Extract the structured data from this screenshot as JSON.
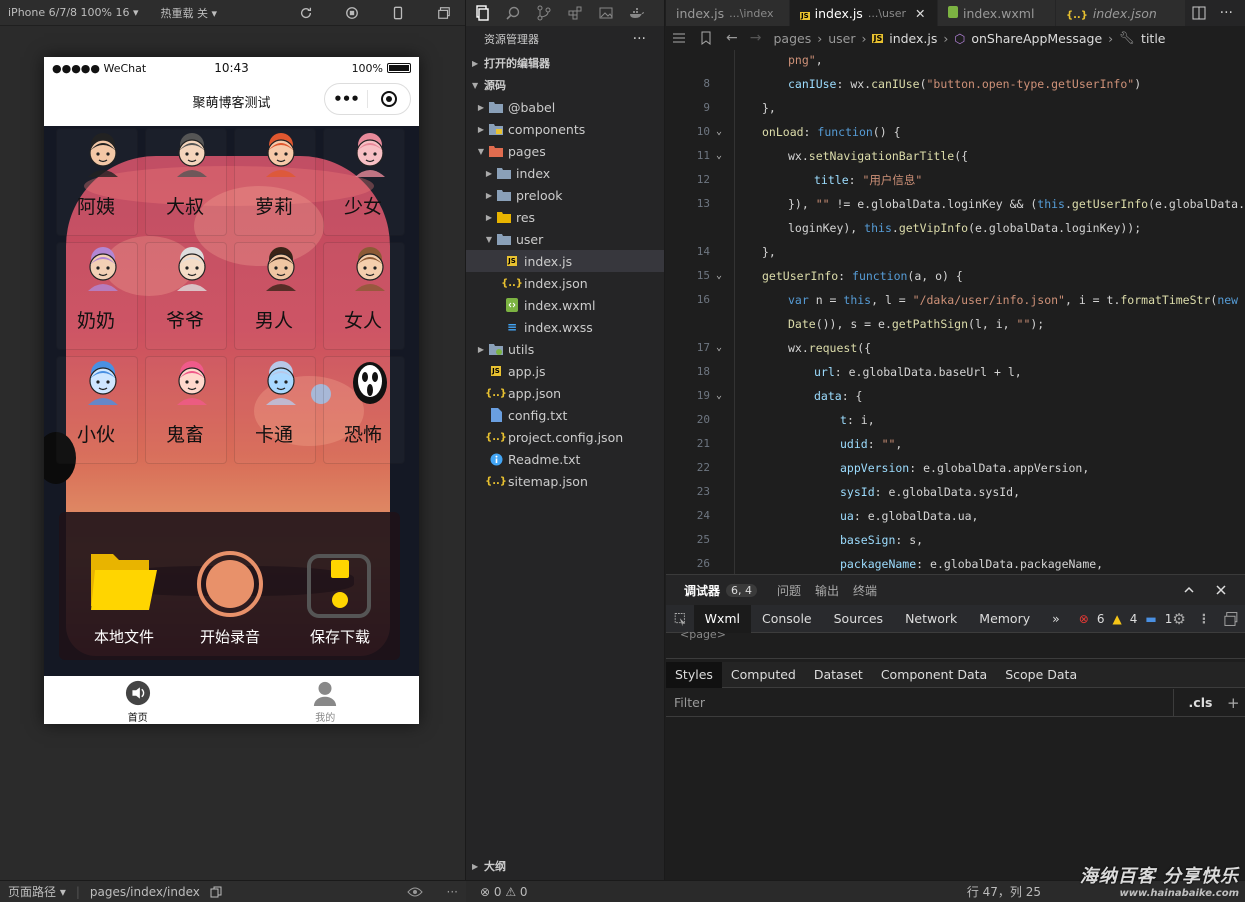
{
  "simulator": {
    "device_label": "iPhone 6/7/8 100% 16",
    "hot_reload_label": "热重载 关",
    "status_bar": {
      "carrier": "●●●●● WeChat",
      "time": "10:43",
      "battery": "100%"
    },
    "nav_title": "聚萌博客测试",
    "capsule_menu": "•••",
    "voices": [
      {
        "label": "阿姨",
        "icon": "aunt-avatar-icon"
      },
      {
        "label": "大叔",
        "icon": "uncle-avatar-icon"
      },
      {
        "label": "萝莉",
        "icon": "loli-avatar-icon"
      },
      {
        "label": "少女",
        "icon": "girl-avatar-icon"
      },
      {
        "label": "奶奶",
        "icon": "grandma-avatar-icon"
      },
      {
        "label": "爷爷",
        "icon": "grandpa-avatar-icon"
      },
      {
        "label": "男人",
        "icon": "man-avatar-icon"
      },
      {
        "label": "女人",
        "icon": "woman-avatar-icon"
      },
      {
        "label": "小伙",
        "icon": "boy-avatar-icon"
      },
      {
        "label": "鬼畜",
        "icon": "clown-avatar-icon"
      },
      {
        "label": "卡通",
        "icon": "cartoon-cat-icon"
      },
      {
        "label": "恐怖",
        "icon": "scream-mask-icon"
      }
    ],
    "actions": [
      {
        "label": "本地文件",
        "icon": "folder-icon"
      },
      {
        "label": "开始录音",
        "icon": "record-icon"
      },
      {
        "label": "保存下载",
        "icon": "save-icon"
      }
    ],
    "tabs": [
      {
        "label": "首页",
        "icon": "speaker-icon"
      },
      {
        "label": "我的",
        "icon": "user-icon"
      }
    ],
    "footer": {
      "path_label": "页面路径",
      "path": "pages/index/index"
    }
  },
  "explorer": {
    "title": "资源管理器",
    "open_editors": "打开的编辑器",
    "source": "源码",
    "outline": "大纲",
    "tree": [
      {
        "name": "@babel",
        "depth": 1,
        "kind": "folder",
        "state": "closed"
      },
      {
        "name": "components",
        "depth": 1,
        "kind": "folder-components",
        "state": "closed"
      },
      {
        "name": "pages",
        "depth": 1,
        "kind": "folder-pages",
        "state": "open"
      },
      {
        "name": "index",
        "depth": 2,
        "kind": "folder",
        "state": "closed"
      },
      {
        "name": "prelook",
        "depth": 2,
        "kind": "folder",
        "state": "closed"
      },
      {
        "name": "res",
        "depth": 2,
        "kind": "folder-yellow",
        "state": "closed"
      },
      {
        "name": "user",
        "depth": 2,
        "kind": "folder",
        "state": "open"
      },
      {
        "name": "index.js",
        "depth": 3,
        "kind": "js",
        "selected": true
      },
      {
        "name": "index.json",
        "depth": 3,
        "kind": "json"
      },
      {
        "name": "index.wxml",
        "depth": 3,
        "kind": "wxml"
      },
      {
        "name": "index.wxss",
        "depth": 3,
        "kind": "wxss"
      },
      {
        "name": "utils",
        "depth": 1,
        "kind": "folder-utils",
        "state": "closed"
      },
      {
        "name": "app.js",
        "depth": 1,
        "kind": "js"
      },
      {
        "name": "app.json",
        "depth": 1,
        "kind": "json"
      },
      {
        "name": "config.txt",
        "depth": 1,
        "kind": "txt"
      },
      {
        "name": "project.config.json",
        "depth": 1,
        "kind": "json"
      },
      {
        "name": "Readme.txt",
        "depth": 1,
        "kind": "info"
      },
      {
        "name": "sitemap.json",
        "depth": 1,
        "kind": "json"
      }
    ]
  },
  "editor": {
    "tabs": [
      {
        "label": "index.js",
        "sub": "...\\index",
        "active": false,
        "kind": "plain"
      },
      {
        "label": "index.js",
        "sub": "...\\user",
        "active": true,
        "kind": "js",
        "close": "✕"
      },
      {
        "label": "index.wxml",
        "sub": "",
        "active": false,
        "kind": "wxml"
      },
      {
        "label": "index.json",
        "sub": "",
        "active": false,
        "kind": "json",
        "italic": true
      }
    ],
    "breadcrumbs": [
      "pages",
      "user",
      "index.js",
      "onShareAppMessage",
      "title"
    ],
    "lines": [
      {
        "n": "",
        "fold": false,
        "indent": 1,
        "tokens": [
          [
            "str",
            "png\""
          ],
          [
            "",
            ","
          ]
        ]
      },
      {
        "n": "8",
        "fold": false,
        "indent": 1,
        "tokens": [
          [
            "prop",
            "canIUse"
          ],
          [
            "",
            ": wx."
          ],
          [
            "fn",
            "canIUse"
          ],
          [
            "",
            "("
          ],
          [
            "str",
            "\"button.open-type.getUserInfo\""
          ],
          [
            "",
            ")"
          ]
        ]
      },
      {
        "n": "9",
        "fold": false,
        "indent": 0,
        "tokens": [
          [
            "",
            "},"
          ]
        ]
      },
      {
        "n": "10",
        "fold": true,
        "indent": 0,
        "tokens": [
          [
            "fn",
            "onLoad"
          ],
          [
            "",
            ": "
          ],
          [
            "kw",
            "function"
          ],
          [
            "",
            "() {"
          ]
        ]
      },
      {
        "n": "11",
        "fold": true,
        "indent": 1,
        "tokens": [
          [
            "",
            "wx."
          ],
          [
            "fn",
            "setNavigationBarTitle"
          ],
          [
            "",
            "({"
          ]
        ]
      },
      {
        "n": "12",
        "fold": false,
        "indent": 2,
        "tokens": [
          [
            "prop",
            "title"
          ],
          [
            "",
            ": "
          ],
          [
            "str",
            "\"用户信息\""
          ]
        ]
      },
      {
        "n": "13",
        "fold": false,
        "indent": 1,
        "tokens": [
          [
            "",
            "}), "
          ],
          [
            "str",
            "\"\""
          ],
          [
            "",
            " != e.globalData.loginKey && ("
          ],
          [
            "th",
            "this"
          ],
          [
            "",
            "."
          ],
          [
            "fn",
            "getUserInfo"
          ],
          [
            "",
            "(e.globalData."
          ]
        ]
      },
      {
        "n": "",
        "fold": false,
        "indent": 1,
        "tokens": [
          [
            "",
            "loginKey), "
          ],
          [
            "th",
            "this"
          ],
          [
            "",
            "."
          ],
          [
            "fn",
            "getVipInfo"
          ],
          [
            "",
            "(e.globalData.loginKey));"
          ]
        ]
      },
      {
        "n": "14",
        "fold": false,
        "indent": 0,
        "tokens": [
          [
            "",
            "},"
          ]
        ]
      },
      {
        "n": "15",
        "fold": true,
        "indent": 0,
        "tokens": [
          [
            "fn",
            "getUserInfo"
          ],
          [
            "",
            ": "
          ],
          [
            "kw",
            "function"
          ],
          [
            "",
            "(a, o) {"
          ]
        ]
      },
      {
        "n": "16",
        "fold": false,
        "indent": 1,
        "tokens": [
          [
            "kw",
            "var"
          ],
          [
            "",
            " n = "
          ],
          [
            "th",
            "this"
          ],
          [
            "",
            ", l = "
          ],
          [
            "str",
            "\"/daka/user/info.json\""
          ],
          [
            "",
            ", i = t."
          ],
          [
            "fn",
            "formatTimeStr"
          ],
          [
            "",
            "("
          ],
          [
            "kw",
            "new"
          ]
        ]
      },
      {
        "n": "",
        "fold": false,
        "indent": 1,
        "tokens": [
          [
            "fn",
            "Date"
          ],
          [
            "",
            "()), s = e."
          ],
          [
            "fn",
            "getPathSign"
          ],
          [
            "",
            "(l, i, "
          ],
          [
            "str",
            "\"\""
          ],
          [
            "",
            ");"
          ]
        ]
      },
      {
        "n": "17",
        "fold": true,
        "indent": 1,
        "tokens": [
          [
            "",
            "wx."
          ],
          [
            "fn",
            "request"
          ],
          [
            "",
            "({"
          ]
        ]
      },
      {
        "n": "18",
        "fold": false,
        "indent": 2,
        "tokens": [
          [
            "prop",
            "url"
          ],
          [
            "",
            ": e.globalData.baseUrl + l,"
          ]
        ]
      },
      {
        "n": "19",
        "fold": true,
        "indent": 2,
        "tokens": [
          [
            "prop",
            "data"
          ],
          [
            "",
            ": {"
          ]
        ]
      },
      {
        "n": "20",
        "fold": false,
        "indent": 3,
        "tokens": [
          [
            "prop",
            "t"
          ],
          [
            "",
            ": i,"
          ]
        ]
      },
      {
        "n": "21",
        "fold": false,
        "indent": 3,
        "tokens": [
          [
            "prop",
            "udid"
          ],
          [
            "",
            ": "
          ],
          [
            "str",
            "\"\""
          ],
          [
            "",
            ","
          ]
        ]
      },
      {
        "n": "22",
        "fold": false,
        "indent": 3,
        "tokens": [
          [
            "prop",
            "appVersion"
          ],
          [
            "",
            ": e.globalData.appVersion,"
          ]
        ]
      },
      {
        "n": "23",
        "fold": false,
        "indent": 3,
        "tokens": [
          [
            "prop",
            "sysId"
          ],
          [
            "",
            ": e.globalData.sysId,"
          ]
        ]
      },
      {
        "n": "24",
        "fold": false,
        "indent": 3,
        "tokens": [
          [
            "prop",
            "ua"
          ],
          [
            "",
            ": e.globalData.ua,"
          ]
        ]
      },
      {
        "n": "25",
        "fold": false,
        "indent": 3,
        "tokens": [
          [
            "prop",
            "baseSign"
          ],
          [
            "",
            ": s,"
          ]
        ]
      },
      {
        "n": "26",
        "fold": false,
        "indent": 3,
        "tokens": [
          [
            "prop",
            "packageName"
          ],
          [
            "",
            ": e.globalData.packageName,"
          ]
        ]
      }
    ]
  },
  "debug": {
    "tabs": [
      "调试器",
      "问题",
      "输出",
      "终端"
    ],
    "badge": "6, 4",
    "devtools_tabs": [
      "Wxml",
      "Console",
      "Sources",
      "Network",
      "Memory"
    ],
    "more": "»",
    "errors": "6",
    "warnings": "4",
    "infos": "1",
    "tree_peek": "<page>",
    "style_tabs": [
      "Styles",
      "Computed",
      "Dataset",
      "Component Data",
      "Scope Data"
    ],
    "filter_placeholder": "Filter",
    "cls_label": ".cls",
    "plus": "+"
  },
  "statusbar": {
    "problems": "⊗ 0 ⚠ 0",
    "cursor": "行 47，列 25"
  },
  "watermark": {
    "line1": "海纳百客 分享快乐",
    "line2": "www.hainabaike.com"
  },
  "colors": {
    "accent_yellow": "#ffd500",
    "record_orange": "#e8916a",
    "error_red": "#e53935",
    "warning_yellow": "#f5c518",
    "info_blue": "#4a90e2"
  }
}
